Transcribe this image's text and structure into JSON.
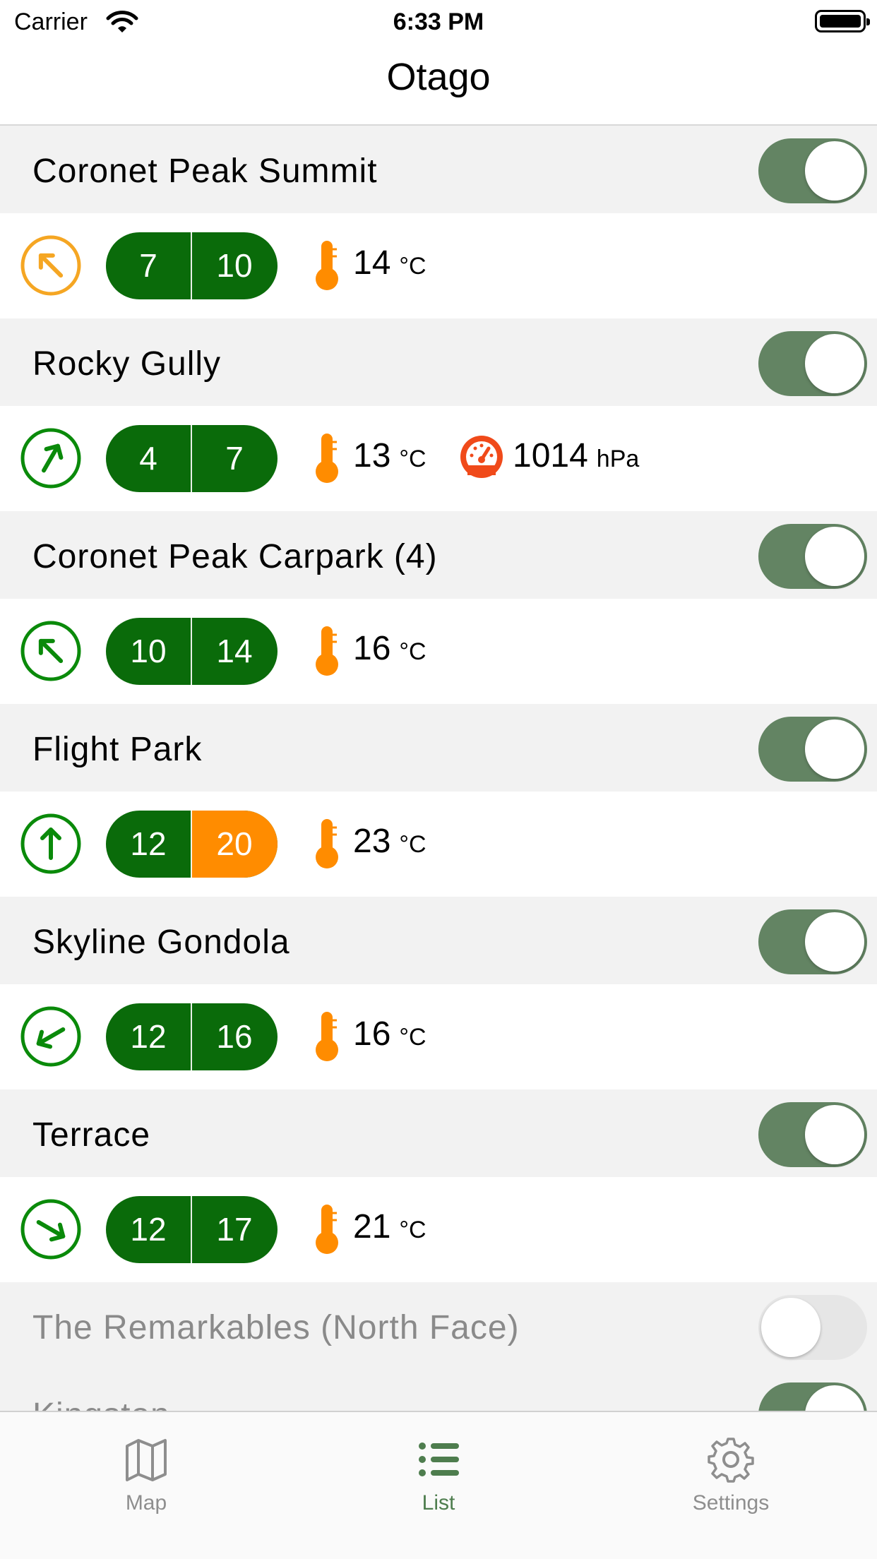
{
  "status_bar": {
    "carrier": "Carrier",
    "time": "6:33 PM"
  },
  "nav": {
    "title": "Otago"
  },
  "colors": {
    "accent_green": "#0a6b0a",
    "warning_orange": "#ff8c00",
    "toggle_on": "#638463",
    "direction_amber": "#f5a623"
  },
  "stations": [
    {
      "name": "Coronet Peak Summit",
      "enabled": true,
      "direction_icon": "arrow-up-left-icon",
      "direction_color": "#f5a623",
      "avg": "7",
      "gust": "10",
      "gust_warning": false,
      "temp": "14",
      "temp_unit": "°C",
      "pressure": null,
      "pressure_unit": null
    },
    {
      "name": "Rocky Gully",
      "enabled": true,
      "direction_icon": "arrow-up-right-icon",
      "direction_color": "#0a8a0a",
      "avg": "4",
      "gust": "7",
      "gust_warning": false,
      "temp": "13",
      "temp_unit": "°C",
      "pressure": "1014",
      "pressure_unit": "hPa"
    },
    {
      "name": "Coronet Peak Carpark (4)",
      "enabled": true,
      "direction_icon": "arrow-up-left-icon",
      "direction_color": "#0a8a0a",
      "avg": "10",
      "gust": "14",
      "gust_warning": false,
      "temp": "16",
      "temp_unit": "°C",
      "pressure": null,
      "pressure_unit": null
    },
    {
      "name": "Flight Park",
      "enabled": true,
      "direction_icon": "arrow-up-icon",
      "direction_color": "#0a8a0a",
      "avg": "12",
      "gust": "20",
      "gust_warning": true,
      "temp": "23",
      "temp_unit": "°C",
      "pressure": null,
      "pressure_unit": null
    },
    {
      "name": "Skyline Gondola",
      "enabled": true,
      "direction_icon": "arrow-down-left-icon",
      "direction_color": "#0a8a0a",
      "avg": "12",
      "gust": "16",
      "gust_warning": false,
      "temp": "16",
      "temp_unit": "°C",
      "pressure": null,
      "pressure_unit": null
    },
    {
      "name": "Terrace",
      "enabled": true,
      "direction_icon": "arrow-down-right-icon",
      "direction_color": "#0a8a0a",
      "avg": "12",
      "gust": "17",
      "gust_warning": false,
      "temp": "21",
      "temp_unit": "°C",
      "pressure": null,
      "pressure_unit": null
    },
    {
      "name": "The Remarkables (North Face)",
      "enabled": false
    },
    {
      "name": "Kingston",
      "enabled": true
    }
  ],
  "tabs": [
    {
      "label": "Map",
      "icon": "map-icon",
      "active": false
    },
    {
      "label": "List",
      "icon": "list-icon",
      "active": true
    },
    {
      "label": "Settings",
      "icon": "gear-icon",
      "active": false
    }
  ]
}
